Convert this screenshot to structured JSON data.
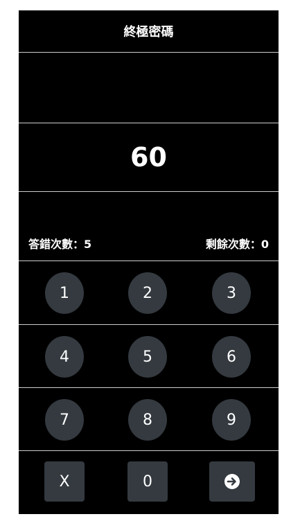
{
  "app": {
    "title": "終極密碼",
    "timer": "60",
    "wrong_count_label": "答錯次數：5",
    "remaining_count_label": "剩餘次數：0"
  },
  "keypad": {
    "rows": [
      [
        "1",
        "2",
        "3"
      ],
      [
        "4",
        "5",
        "6"
      ],
      [
        "7",
        "8",
        "9"
      ]
    ],
    "bottom": {
      "clear_label": "X",
      "zero_label": "0",
      "enter_icon": "arrow-right-circle-icon"
    }
  },
  "colors": {
    "background": "#000000",
    "key": "#343a40",
    "text": "#ffffff",
    "divider": "#cfcfcf"
  }
}
